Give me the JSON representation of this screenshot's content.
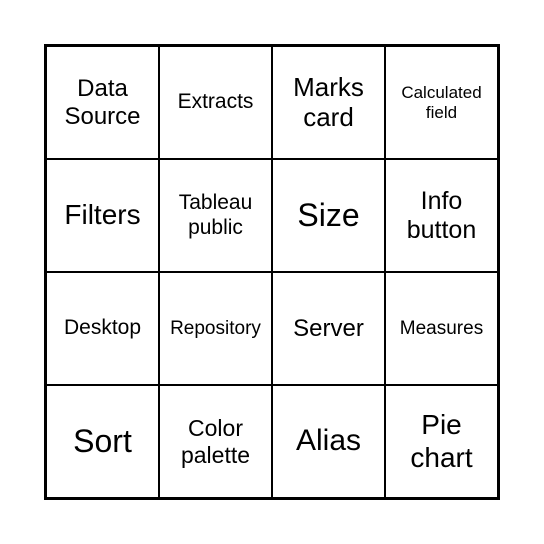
{
  "grid": {
    "rows": [
      [
        "Data Source",
        "Extracts",
        "Marks card",
        "Calculated field"
      ],
      [
        "Filters",
        "Tableau public",
        "Size",
        "Info button"
      ],
      [
        "Desktop",
        "Repository",
        "Server",
        "Measures"
      ],
      [
        "Sort",
        "Color palette",
        "Alias",
        "Pie chart"
      ]
    ]
  },
  "fontSizes": [
    [
      24,
      21,
      26,
      17
    ],
    [
      28,
      21,
      32,
      25
    ],
    [
      21,
      19,
      24,
      19
    ],
    [
      32,
      23,
      30,
      28
    ]
  ]
}
